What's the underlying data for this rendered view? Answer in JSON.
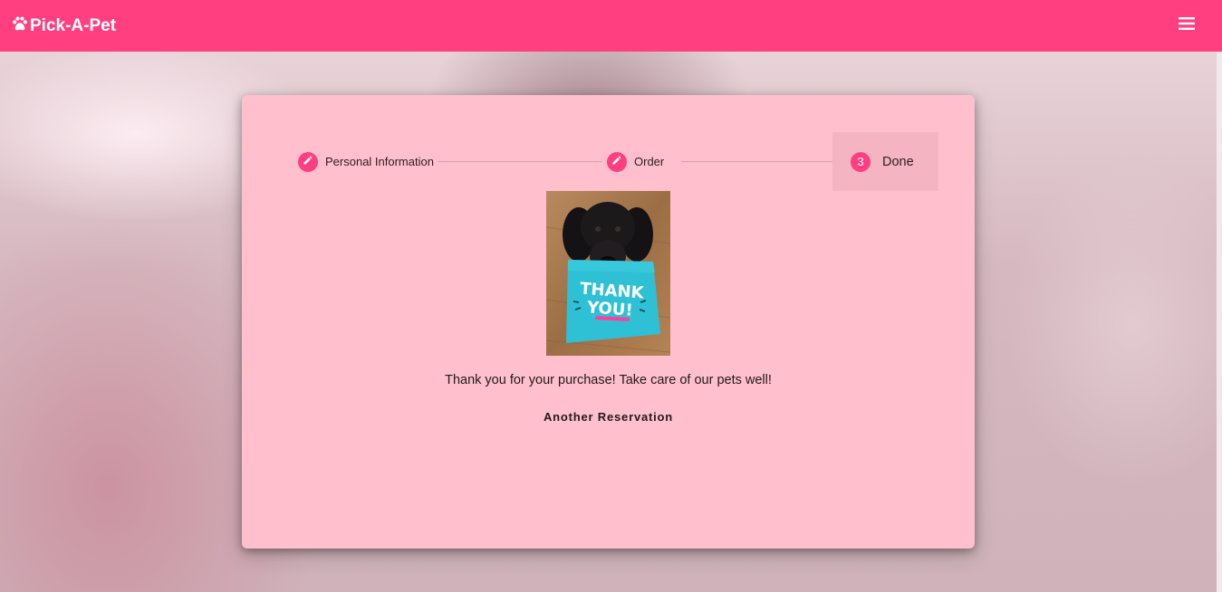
{
  "app": {
    "title": "Pick-A-Pet",
    "brand_color": "#ff3f7f",
    "logo_icon": "paw-icon",
    "menu_icon": "hamburger-menu-icon"
  },
  "stepper": {
    "steps": [
      {
        "label": "Personal Information",
        "state": "completed",
        "icon": "pencil-icon"
      },
      {
        "label": "Order",
        "state": "completed",
        "icon": "pencil-icon"
      },
      {
        "label": "Done",
        "state": "active",
        "number": "3"
      }
    ]
  },
  "done": {
    "image_text": [
      "THANK",
      "YOU!"
    ],
    "message": "Thank you for your purchase! Take care of our pets well!",
    "another_button_label": "Another Reservation"
  },
  "colors": {
    "card_background": "#ffbfcc",
    "active_step_background": "#f4b4c2"
  }
}
